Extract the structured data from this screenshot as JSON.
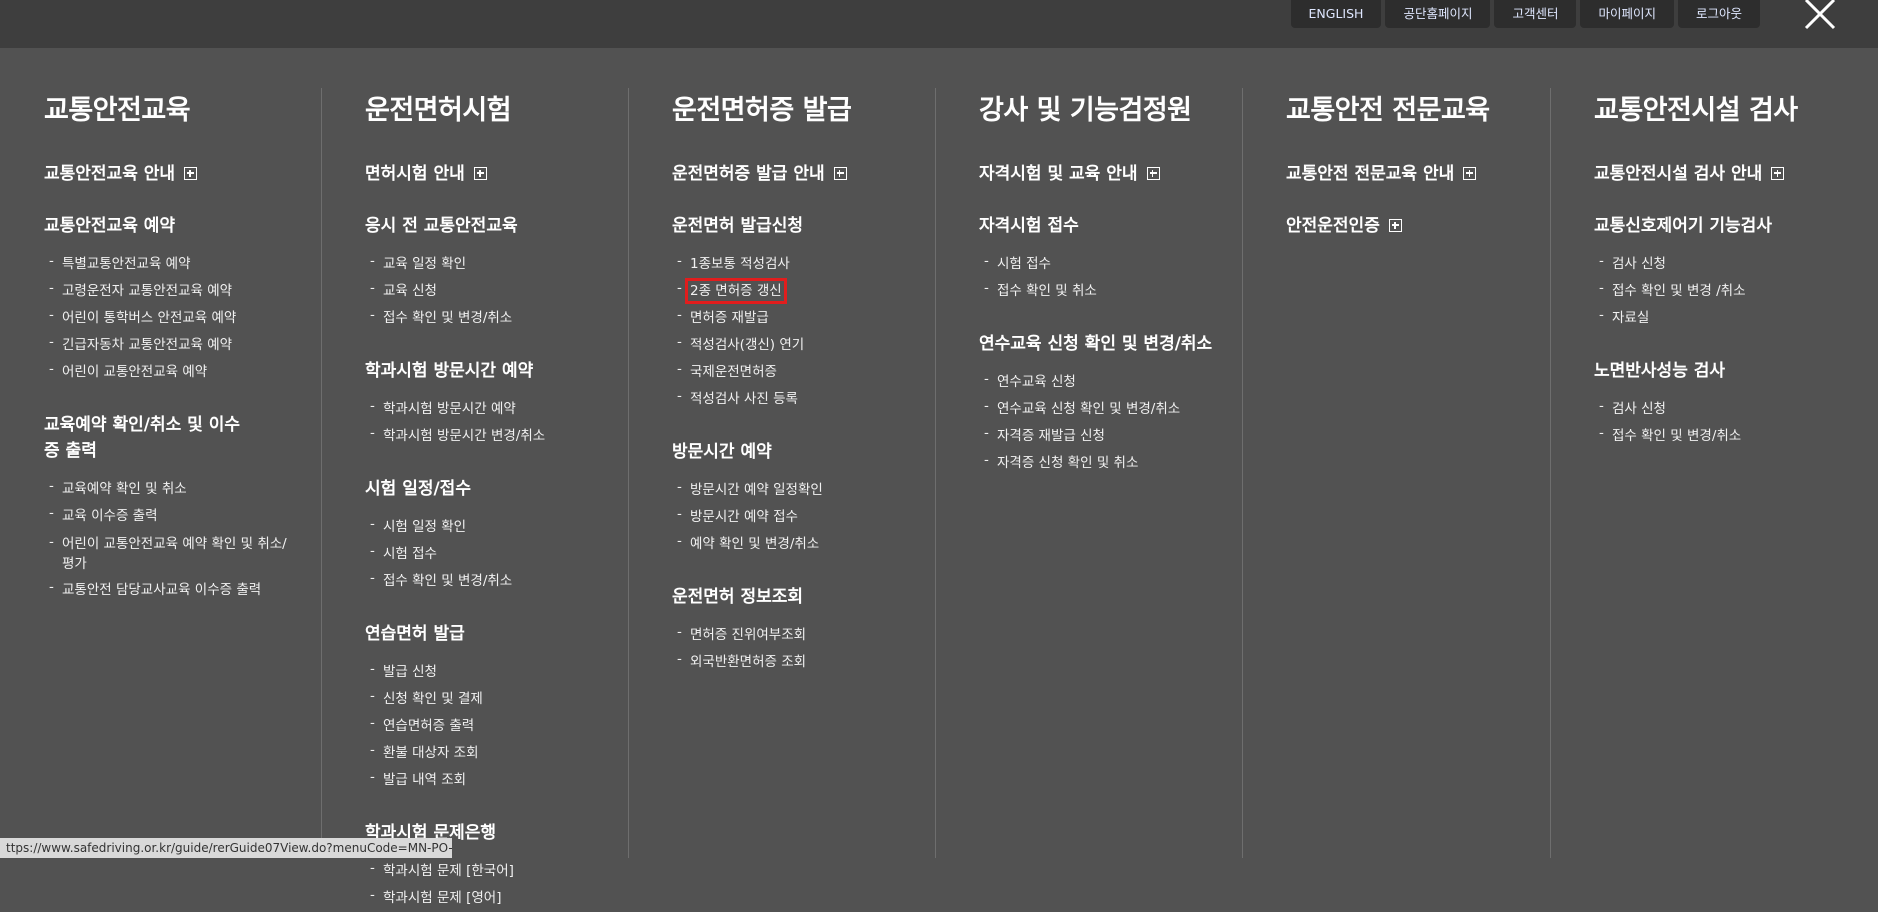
{
  "top_links": [
    "ENGLISH",
    "공단홈페이지",
    "고객센터",
    "마이페이지",
    "로그아웃"
  ],
  "columns": [
    {
      "title": "교통안전교육",
      "sections": [
        {
          "title": "교통안전교육 안내",
          "plus": true,
          "items": []
        },
        {
          "title": "교통안전교육 예약",
          "plus": false,
          "items": [
            "특별교통안전교육 예약",
            "고령운전자 교통안전교육 예약",
            "어린이 통학버스 안전교육 예약",
            "긴급자동차 교통안전교육 예약",
            "어린이 교통안전교육 예약"
          ]
        },
        {
          "title": "교육예약 확인/취소 및 이수증 출력",
          "plus": false,
          "items": [
            "교육예약 확인 및 취소",
            "교육 이수증 출력",
            "어린이 교통안전교육 예약 확인 및 취소/평가",
            "교통안전 담당교사교육 이수증 출력"
          ]
        }
      ]
    },
    {
      "title": "운전면허시험",
      "sections": [
        {
          "title": "면허시험 안내",
          "plus": true,
          "items": []
        },
        {
          "title": "응시 전 교통안전교육",
          "plus": false,
          "items": [
            "교육 일정 확인",
            "교육 신청",
            "접수 확인 및 변경/취소"
          ]
        },
        {
          "title": "학과시험 방문시간 예약",
          "plus": false,
          "items": [
            "학과시험 방문시간 예약",
            "학과시험 방문시간 변경/취소"
          ]
        },
        {
          "title": "시험 일정/접수",
          "plus": false,
          "items": [
            "시험 일정 확인",
            "시험 접수",
            "접수 확인 및 변경/취소"
          ]
        },
        {
          "title": "연습면허 발급",
          "plus": false,
          "items": [
            "발급 신청",
            "신청 확인 및 결제",
            "연습면허증 출력",
            "환불 대상자 조회",
            "발급 내역 조회"
          ]
        },
        {
          "title": "학과시험 문제은행",
          "plus": false,
          "items": [
            "학과시험 문제 [한국어]",
            "학과시험 문제 [영어]"
          ]
        }
      ]
    },
    {
      "title": "운전면허증 발급",
      "sections": [
        {
          "title": "운전면허증 발급 안내",
          "plus": true,
          "items": []
        },
        {
          "title": "운전면허 발급신청",
          "plus": false,
          "items": [
            "1종보통 적성검사",
            "2종 면허증 갱신",
            "면허증 재발급",
            "적성검사(갱신) 연기",
            "국제운전면허증",
            "적성검사 사진 등록"
          ]
        },
        {
          "title": "방문시간 예약",
          "plus": false,
          "items": [
            "방문시간 예약 일정확인",
            "방문시간 예약 접수",
            "예약 확인 및 변경/취소"
          ]
        },
        {
          "title": "운전면허 정보조회",
          "plus": false,
          "items": [
            "면허증 진위여부조회",
            "외국반환면허증 조회"
          ]
        }
      ]
    },
    {
      "title": "강사 및 기능검정원",
      "sections": [
        {
          "title": "자격시험 및 교육 안내",
          "plus": true,
          "items": []
        },
        {
          "title": "자격시험 접수",
          "plus": false,
          "items": [
            "시험 접수",
            "접수 확인 및 취소"
          ]
        },
        {
          "title": "연수교육 신청 확인 및 변경/취소",
          "plus": false,
          "items": [
            "연수교육 신청",
            "연수교육 신청 확인 및 변경/취소",
            "자격증 재발급 신청",
            "자격증 신청 확인 및 취소"
          ]
        }
      ]
    },
    {
      "title": "교통안전 전문교육",
      "sections": [
        {
          "title": "교통안전 전문교육 안내",
          "plus": true,
          "items": []
        },
        {
          "title": "안전운전인증",
          "plus": true,
          "items": []
        }
      ]
    },
    {
      "title": "교통안전시설 검사",
      "sections": [
        {
          "title": "교통안전시설 검사 안내",
          "plus": true,
          "items": []
        },
        {
          "title": "교통신호제어기 기능검사",
          "plus": false,
          "items": [
            "검사 신청",
            "접수 확인 및 변경 /취소",
            "자료실"
          ]
        },
        {
          "title": "노면반사성능 검사",
          "plus": false,
          "items": [
            "검사 신청",
            "접수 확인 및 변경/취소"
          ]
        }
      ]
    }
  ],
  "status_url": "ttps://www.safedriving.or.kr/guide/rerGuide07View.do?menuCode=MN-PO-1117"
}
